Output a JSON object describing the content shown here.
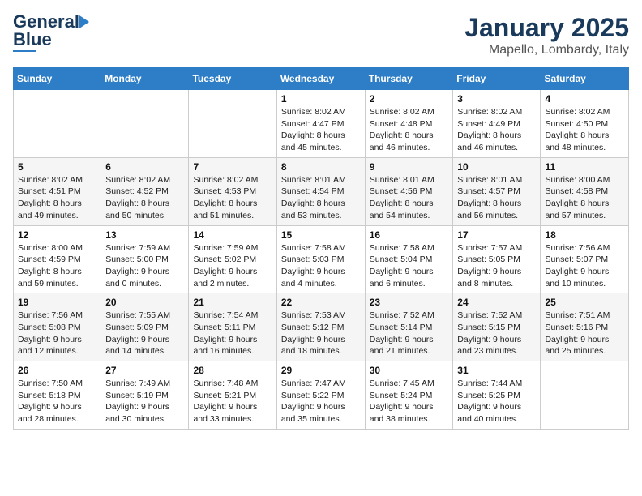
{
  "logo": {
    "general": "General",
    "blue": "Blue"
  },
  "title": "January 2025",
  "subtitle": "Mapello, Lombardy, Italy",
  "days_of_week": [
    "Sunday",
    "Monday",
    "Tuesday",
    "Wednesday",
    "Thursday",
    "Friday",
    "Saturday"
  ],
  "weeks": [
    [
      {
        "day": "",
        "info": ""
      },
      {
        "day": "",
        "info": ""
      },
      {
        "day": "",
        "info": ""
      },
      {
        "day": "1",
        "info": "Sunrise: 8:02 AM\nSunset: 4:47 PM\nDaylight: 8 hours\nand 45 minutes."
      },
      {
        "day": "2",
        "info": "Sunrise: 8:02 AM\nSunset: 4:48 PM\nDaylight: 8 hours\nand 46 minutes."
      },
      {
        "day": "3",
        "info": "Sunrise: 8:02 AM\nSunset: 4:49 PM\nDaylight: 8 hours\nand 46 minutes."
      },
      {
        "day": "4",
        "info": "Sunrise: 8:02 AM\nSunset: 4:50 PM\nDaylight: 8 hours\nand 48 minutes."
      }
    ],
    [
      {
        "day": "5",
        "info": "Sunrise: 8:02 AM\nSunset: 4:51 PM\nDaylight: 8 hours\nand 49 minutes."
      },
      {
        "day": "6",
        "info": "Sunrise: 8:02 AM\nSunset: 4:52 PM\nDaylight: 8 hours\nand 50 minutes."
      },
      {
        "day": "7",
        "info": "Sunrise: 8:02 AM\nSunset: 4:53 PM\nDaylight: 8 hours\nand 51 minutes."
      },
      {
        "day": "8",
        "info": "Sunrise: 8:01 AM\nSunset: 4:54 PM\nDaylight: 8 hours\nand 53 minutes."
      },
      {
        "day": "9",
        "info": "Sunrise: 8:01 AM\nSunset: 4:56 PM\nDaylight: 8 hours\nand 54 minutes."
      },
      {
        "day": "10",
        "info": "Sunrise: 8:01 AM\nSunset: 4:57 PM\nDaylight: 8 hours\nand 56 minutes."
      },
      {
        "day": "11",
        "info": "Sunrise: 8:00 AM\nSunset: 4:58 PM\nDaylight: 8 hours\nand 57 minutes."
      }
    ],
    [
      {
        "day": "12",
        "info": "Sunrise: 8:00 AM\nSunset: 4:59 PM\nDaylight: 8 hours\nand 59 minutes."
      },
      {
        "day": "13",
        "info": "Sunrise: 7:59 AM\nSunset: 5:00 PM\nDaylight: 9 hours\nand 0 minutes."
      },
      {
        "day": "14",
        "info": "Sunrise: 7:59 AM\nSunset: 5:02 PM\nDaylight: 9 hours\nand 2 minutes."
      },
      {
        "day": "15",
        "info": "Sunrise: 7:58 AM\nSunset: 5:03 PM\nDaylight: 9 hours\nand 4 minutes."
      },
      {
        "day": "16",
        "info": "Sunrise: 7:58 AM\nSunset: 5:04 PM\nDaylight: 9 hours\nand 6 minutes."
      },
      {
        "day": "17",
        "info": "Sunrise: 7:57 AM\nSunset: 5:05 PM\nDaylight: 9 hours\nand 8 minutes."
      },
      {
        "day": "18",
        "info": "Sunrise: 7:56 AM\nSunset: 5:07 PM\nDaylight: 9 hours\nand 10 minutes."
      }
    ],
    [
      {
        "day": "19",
        "info": "Sunrise: 7:56 AM\nSunset: 5:08 PM\nDaylight: 9 hours\nand 12 minutes."
      },
      {
        "day": "20",
        "info": "Sunrise: 7:55 AM\nSunset: 5:09 PM\nDaylight: 9 hours\nand 14 minutes."
      },
      {
        "day": "21",
        "info": "Sunrise: 7:54 AM\nSunset: 5:11 PM\nDaylight: 9 hours\nand 16 minutes."
      },
      {
        "day": "22",
        "info": "Sunrise: 7:53 AM\nSunset: 5:12 PM\nDaylight: 9 hours\nand 18 minutes."
      },
      {
        "day": "23",
        "info": "Sunrise: 7:52 AM\nSunset: 5:14 PM\nDaylight: 9 hours\nand 21 minutes."
      },
      {
        "day": "24",
        "info": "Sunrise: 7:52 AM\nSunset: 5:15 PM\nDaylight: 9 hours\nand 23 minutes."
      },
      {
        "day": "25",
        "info": "Sunrise: 7:51 AM\nSunset: 5:16 PM\nDaylight: 9 hours\nand 25 minutes."
      }
    ],
    [
      {
        "day": "26",
        "info": "Sunrise: 7:50 AM\nSunset: 5:18 PM\nDaylight: 9 hours\nand 28 minutes."
      },
      {
        "day": "27",
        "info": "Sunrise: 7:49 AM\nSunset: 5:19 PM\nDaylight: 9 hours\nand 30 minutes."
      },
      {
        "day": "28",
        "info": "Sunrise: 7:48 AM\nSunset: 5:21 PM\nDaylight: 9 hours\nand 33 minutes."
      },
      {
        "day": "29",
        "info": "Sunrise: 7:47 AM\nSunset: 5:22 PM\nDaylight: 9 hours\nand 35 minutes."
      },
      {
        "day": "30",
        "info": "Sunrise: 7:45 AM\nSunset: 5:24 PM\nDaylight: 9 hours\nand 38 minutes."
      },
      {
        "day": "31",
        "info": "Sunrise: 7:44 AM\nSunset: 5:25 PM\nDaylight: 9 hours\nand 40 minutes."
      },
      {
        "day": "",
        "info": ""
      }
    ]
  ]
}
